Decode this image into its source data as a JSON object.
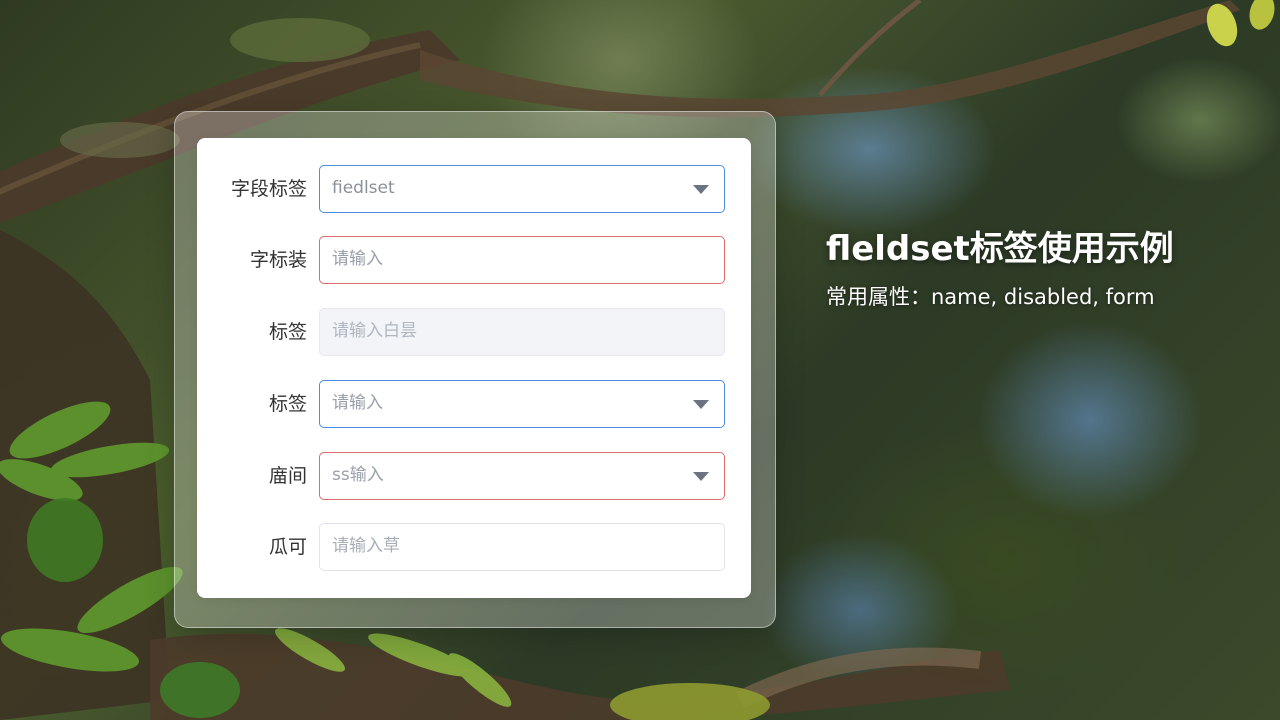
{
  "slide": {
    "title": "fleldset标签使用示例",
    "subtitle": "常用属性：name, disabled, form"
  },
  "form": {
    "rows": [
      {
        "label": "字段标签",
        "value": "fiedlset",
        "placeholder": "",
        "type": "select",
        "state": "focused"
      },
      {
        "label": "字标装",
        "value": "",
        "placeholder": "请输入",
        "type": "text",
        "state": "error"
      },
      {
        "label": "标签",
        "value": "",
        "placeholder": "请输入白昙",
        "type": "text",
        "state": "disabled"
      },
      {
        "label": "标签",
        "value": "",
        "placeholder": "请输入",
        "type": "select",
        "state": "focused"
      },
      {
        "label": "庿间",
        "value": "",
        "placeholder": "ss输入",
        "type": "select",
        "state": "error"
      },
      {
        "label": "瓜可",
        "value": "",
        "placeholder": "请输入草",
        "type": "text",
        "state": "default"
      }
    ]
  },
  "colors": {
    "focus_border": "#4a8fe0",
    "error_border": "#e06b6b",
    "disabled_bg": "#f2f4f8"
  },
  "icons": {
    "select_arrow": "chevron-down-icon"
  }
}
